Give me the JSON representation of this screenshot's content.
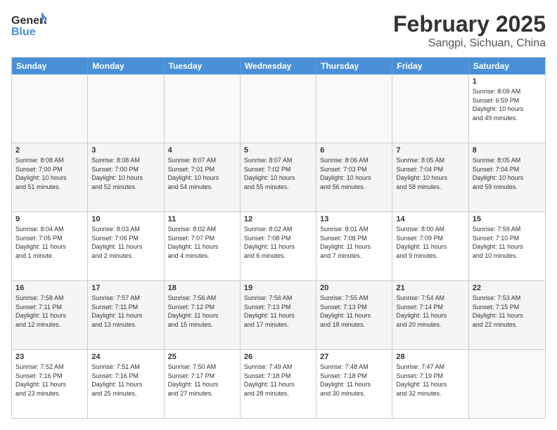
{
  "header": {
    "logo_general": "General",
    "logo_blue": "Blue",
    "month_year": "February 2025",
    "location": "Sangpi, Sichuan, China"
  },
  "weekdays": [
    "Sunday",
    "Monday",
    "Tuesday",
    "Wednesday",
    "Thursday",
    "Friday",
    "Saturday"
  ],
  "weeks": [
    [
      {
        "day": "",
        "info": ""
      },
      {
        "day": "",
        "info": ""
      },
      {
        "day": "",
        "info": ""
      },
      {
        "day": "",
        "info": ""
      },
      {
        "day": "",
        "info": ""
      },
      {
        "day": "",
        "info": ""
      },
      {
        "day": "1",
        "info": "Sunrise: 8:09 AM\nSunset: 6:59 PM\nDaylight: 10 hours\nand 49 minutes."
      }
    ],
    [
      {
        "day": "2",
        "info": "Sunrise: 8:08 AM\nSunset: 7:00 PM\nDaylight: 10 hours\nand 51 minutes."
      },
      {
        "day": "3",
        "info": "Sunrise: 8:08 AM\nSunset: 7:00 PM\nDaylight: 10 hours\nand 52 minutes."
      },
      {
        "day": "4",
        "info": "Sunrise: 8:07 AM\nSunset: 7:01 PM\nDaylight: 10 hours\nand 54 minutes."
      },
      {
        "day": "5",
        "info": "Sunrise: 8:07 AM\nSunset: 7:02 PM\nDaylight: 10 hours\nand 55 minutes."
      },
      {
        "day": "6",
        "info": "Sunrise: 8:06 AM\nSunset: 7:03 PM\nDaylight: 10 hours\nand 56 minutes."
      },
      {
        "day": "7",
        "info": "Sunrise: 8:05 AM\nSunset: 7:04 PM\nDaylight: 10 hours\nand 58 minutes."
      },
      {
        "day": "8",
        "info": "Sunrise: 8:05 AM\nSunset: 7:04 PM\nDaylight: 10 hours\nand 59 minutes."
      }
    ],
    [
      {
        "day": "9",
        "info": "Sunrise: 8:04 AM\nSunset: 7:05 PM\nDaylight: 11 hours\nand 1 minute."
      },
      {
        "day": "10",
        "info": "Sunrise: 8:03 AM\nSunset: 7:06 PM\nDaylight: 11 hours\nand 2 minutes."
      },
      {
        "day": "11",
        "info": "Sunrise: 8:02 AM\nSunset: 7:07 PM\nDaylight: 11 hours\nand 4 minutes."
      },
      {
        "day": "12",
        "info": "Sunrise: 8:02 AM\nSunset: 7:08 PM\nDaylight: 11 hours\nand 6 minutes."
      },
      {
        "day": "13",
        "info": "Sunrise: 8:01 AM\nSunset: 7:08 PM\nDaylight: 11 hours\nand 7 minutes."
      },
      {
        "day": "14",
        "info": "Sunrise: 8:00 AM\nSunset: 7:09 PM\nDaylight: 11 hours\nand 9 minutes."
      },
      {
        "day": "15",
        "info": "Sunrise: 7:59 AM\nSunset: 7:10 PM\nDaylight: 11 hours\nand 10 minutes."
      }
    ],
    [
      {
        "day": "16",
        "info": "Sunrise: 7:58 AM\nSunset: 7:11 PM\nDaylight: 11 hours\nand 12 minutes."
      },
      {
        "day": "17",
        "info": "Sunrise: 7:57 AM\nSunset: 7:11 PM\nDaylight: 11 hours\nand 13 minutes."
      },
      {
        "day": "18",
        "info": "Sunrise: 7:56 AM\nSunset: 7:12 PM\nDaylight: 11 hours\nand 15 minutes."
      },
      {
        "day": "19",
        "info": "Sunrise: 7:56 AM\nSunset: 7:13 PM\nDaylight: 11 hours\nand 17 minutes."
      },
      {
        "day": "20",
        "info": "Sunrise: 7:55 AM\nSunset: 7:13 PM\nDaylight: 11 hours\nand 18 minutes."
      },
      {
        "day": "21",
        "info": "Sunrise: 7:54 AM\nSunset: 7:14 PM\nDaylight: 11 hours\nand 20 minutes."
      },
      {
        "day": "22",
        "info": "Sunrise: 7:53 AM\nSunset: 7:15 PM\nDaylight: 11 hours\nand 22 minutes."
      }
    ],
    [
      {
        "day": "23",
        "info": "Sunrise: 7:52 AM\nSunset: 7:16 PM\nDaylight: 11 hours\nand 23 minutes."
      },
      {
        "day": "24",
        "info": "Sunrise: 7:51 AM\nSunset: 7:16 PM\nDaylight: 11 hours\nand 25 minutes."
      },
      {
        "day": "25",
        "info": "Sunrise: 7:50 AM\nSunset: 7:17 PM\nDaylight: 11 hours\nand 27 minutes."
      },
      {
        "day": "26",
        "info": "Sunrise: 7:49 AM\nSunset: 7:18 PM\nDaylight: 11 hours\nand 28 minutes."
      },
      {
        "day": "27",
        "info": "Sunrise: 7:48 AM\nSunset: 7:18 PM\nDaylight: 11 hours\nand 30 minutes."
      },
      {
        "day": "28",
        "info": "Sunrise: 7:47 AM\nSunset: 7:19 PM\nDaylight: 11 hours\nand 32 minutes."
      },
      {
        "day": "",
        "info": ""
      }
    ]
  ]
}
